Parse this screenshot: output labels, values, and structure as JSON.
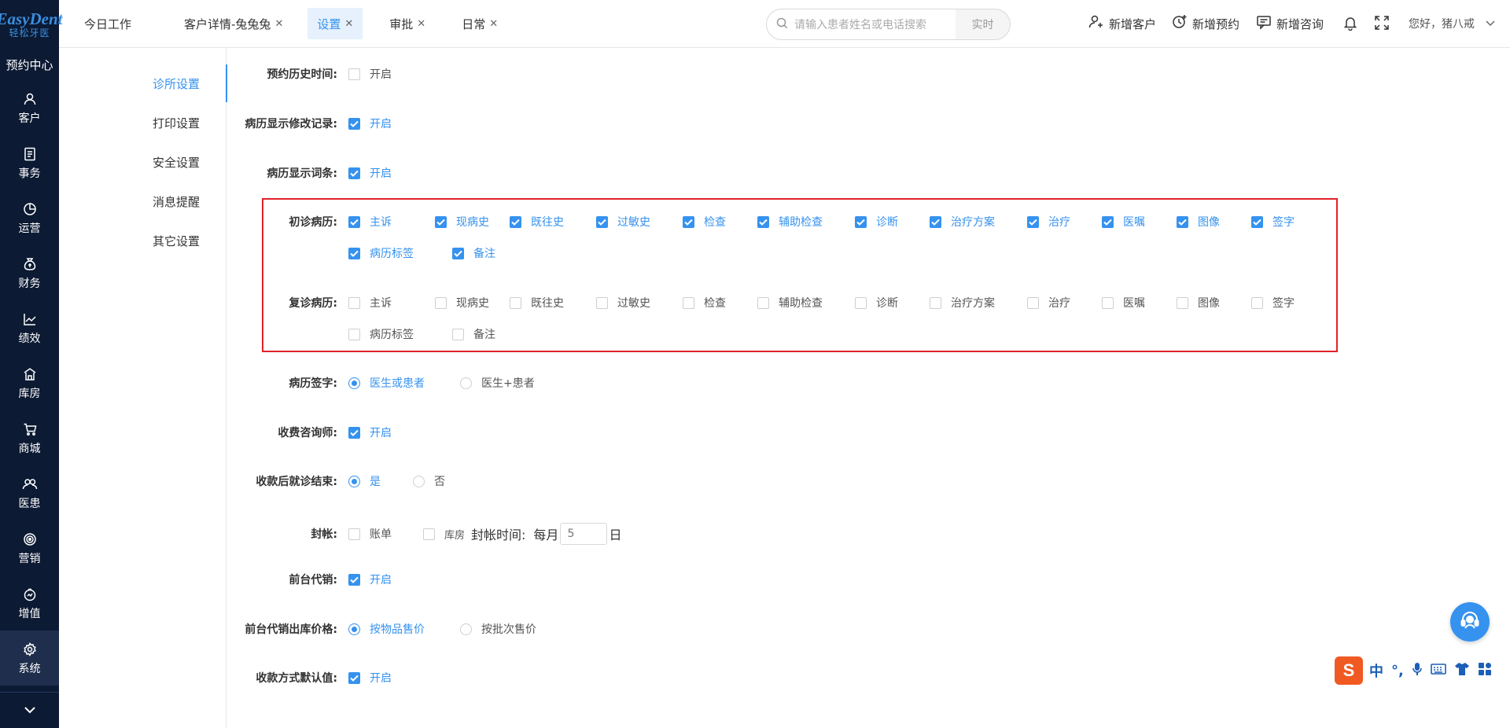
{
  "brand": {
    "line1": "EasyDent",
    "line2": "轻松牙医"
  },
  "sidebar": {
    "title": "预约中心",
    "items": [
      {
        "label": "客户",
        "icon": "user-icon"
      },
      {
        "label": "事务",
        "icon": "document-icon"
      },
      {
        "label": "运营",
        "icon": "pie-chart-icon"
      },
      {
        "label": "财务",
        "icon": "money-bag-icon"
      },
      {
        "label": "绩效",
        "icon": "line-chart-icon"
      },
      {
        "label": "库房",
        "icon": "warehouse-icon"
      },
      {
        "label": "商城",
        "icon": "cart-icon"
      },
      {
        "label": "医患",
        "icon": "people-icon"
      },
      {
        "label": "营销",
        "icon": "target-icon"
      },
      {
        "label": "增值",
        "icon": "growth-icon"
      },
      {
        "label": "系统",
        "icon": "gear-icon"
      }
    ],
    "active": "系统"
  },
  "tabs": [
    {
      "label": "今日工作",
      "closable": false
    },
    {
      "label": "客户详情-兔兔兔",
      "closable": true
    },
    {
      "label": "设置",
      "closable": true,
      "active": true
    },
    {
      "label": "审批",
      "closable": true
    },
    {
      "label": "日常",
      "closable": true
    }
  ],
  "search": {
    "placeholder": "请输入患者姓名或电话搜索",
    "button": "实时"
  },
  "actions": {
    "new_customer": "新增客户",
    "new_appointment": "新增预约",
    "new_consult": "新增咨询",
    "greeting": "您好，猪八戒"
  },
  "settings_menu": [
    "诊所设置",
    "打印设置",
    "安全设置",
    "消息提醒",
    "其它设置"
  ],
  "settings_menu_active": "诊所设置",
  "settings": {
    "appt_history": {
      "label": "预约历史时间:",
      "option": "开启",
      "checked": false
    },
    "record_mod": {
      "label": "病历显示修改记录:",
      "option": "开启",
      "checked": true
    },
    "record_terms": {
      "label": "病历显示词条:",
      "option": "开启",
      "checked": true
    },
    "first_visit": {
      "label": "初诊病历:",
      "options": [
        "主诉",
        "现病史",
        "既往史",
        "过敏史",
        "检查",
        "辅助检查",
        "诊断",
        "治疗方案",
        "治疗",
        "医嘱",
        "图像",
        "签字",
        "病历标签",
        "备注"
      ],
      "checked": [
        true,
        true,
        true,
        true,
        true,
        true,
        true,
        true,
        true,
        true,
        true,
        true,
        true,
        true
      ]
    },
    "return_visit": {
      "label": "复诊病历:",
      "options": [
        "主诉",
        "现病史",
        "既往史",
        "过敏史",
        "检查",
        "辅助检查",
        "诊断",
        "治疗方案",
        "治疗",
        "医嘱",
        "图像",
        "签字",
        "病历标签",
        "备注"
      ],
      "checked": [
        false,
        false,
        false,
        false,
        false,
        false,
        false,
        false,
        false,
        false,
        false,
        false,
        false,
        false
      ]
    },
    "record_sign": {
      "label": "病历签字:",
      "options": [
        "医生或患者",
        "医生+患者"
      ],
      "selected": "医生或患者"
    },
    "fee_consultant": {
      "label": "收费咨询师:",
      "option": "开启",
      "checked": true
    },
    "end_after_pay": {
      "label": "收款后就诊结束:",
      "options": [
        "是",
        "否"
      ],
      "selected": "是"
    },
    "close_account": {
      "label": "封帐:",
      "options": [
        "账单",
        "库房"
      ],
      "checked": [
        false,
        false
      ],
      "time_label": "封帐时间:",
      "monthly": "每月",
      "day_value": "5",
      "day_suffix": "日"
    },
    "front_sale": {
      "label": "前台代销:",
      "option": "开启",
      "checked": true
    },
    "front_sale_price": {
      "label": "前台代销出库价格:",
      "options": [
        "按物品售价",
        "按批次售价"
      ],
      "selected": "按物品售价"
    },
    "payment_default": {
      "label": "收款方式默认值:",
      "option": "开启",
      "checked": true
    }
  },
  "ime": {
    "s": "S",
    "items": [
      "中",
      "°,",
      "mic-icon",
      "keyboard-icon",
      "shirt-icon",
      "grid-icon"
    ]
  },
  "colors": {
    "accent": "#3592ef",
    "sidebar_bg": "#0c1a33",
    "highlight_box": "#e0212a"
  }
}
